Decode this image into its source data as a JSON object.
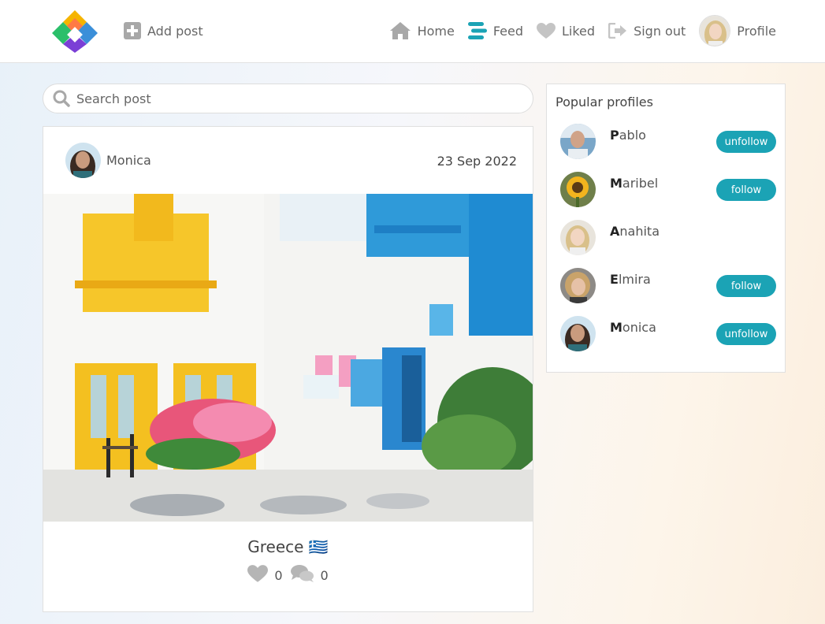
{
  "header": {
    "add_post_label": "Add post",
    "nav": {
      "home": "Home",
      "feed": "Feed",
      "liked": "Liked",
      "sign_out": "Sign out",
      "profile": "Profile"
    }
  },
  "search": {
    "placeholder": "Search post"
  },
  "post": {
    "author": "Monica",
    "date": "23 Sep 2022",
    "title": "Greece 🇬🇷",
    "likes": "0",
    "comments": "0"
  },
  "popular": {
    "title": "Popular profiles",
    "profiles": [
      {
        "initial": "P",
        "rest": "ablo",
        "button": "unfollow"
      },
      {
        "initial": "M",
        "rest": "aribel",
        "button": "follow"
      },
      {
        "initial": "A",
        "rest": "nahita",
        "button": ""
      },
      {
        "initial": "E",
        "rest": "lmira",
        "button": "follow"
      },
      {
        "initial": "M",
        "rest": "onica",
        "button": "unfollow"
      }
    ]
  },
  "colors": {
    "accent": "#1ba3b5",
    "icon": "#a8a8a8",
    "feed_icon": "#1ba3b5"
  }
}
